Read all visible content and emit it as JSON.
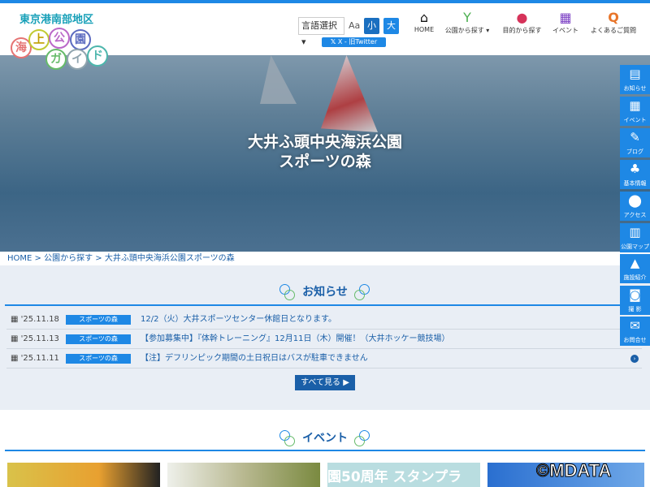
{
  "header": {
    "region": "東京港南部地区",
    "logo_text": [
      "海",
      "上",
      "公",
      "園",
      "ガ",
      "イ",
      "ド"
    ],
    "language_select": "言語選択",
    "font_size_label": "Aa",
    "font_small": "小",
    "font_large": "大",
    "twitter": "X - 旧Twitter",
    "nav": [
      {
        "label": "HOME",
        "icon": "home-icon"
      },
      {
        "label": "公園から探す ▾",
        "icon": "sprout-icon"
      },
      {
        "label": "目的から探す",
        "icon": "ball-icon"
      },
      {
        "label": "イベント",
        "icon": "calendar-icon"
      },
      {
        "label": "よくあるご質問",
        "icon": "q-icon"
      }
    ]
  },
  "hero": {
    "title_line1": "大井ふ頭中央海浜公園",
    "title_line2": "スポーツの森"
  },
  "breadcrumb": [
    "HOME",
    ">",
    "公園から探す",
    ">",
    "大井ふ頭中央海浜公園スポーツの森"
  ],
  "notices": {
    "title": "お知らせ",
    "items": [
      {
        "date": "'25.11.18",
        "tag": "スポーツの森",
        "text": "12/2（火）大井スポーツセンター休館日となります。"
      },
      {
        "date": "'25.11.13",
        "tag": "スポーツの森",
        "text": "【参加募集中】『体幹トレーニング』12月11日（木）開催！（大井ホッケー競技場）"
      },
      {
        "date": "'25.11.11",
        "tag": "スポーツの森",
        "text": "【注】デフリンピック期間の土日祝日はバスが駐車できません"
      }
    ],
    "more": "すべて見る ▶"
  },
  "events": {
    "title": "イベント",
    "card3_text": "園50周年 スタンプラ"
  },
  "sidebar": [
    {
      "label": "お知らせ",
      "icon": "newspaper-icon"
    },
    {
      "label": "イベント",
      "icon": "calendar-icon"
    },
    {
      "label": "ブログ",
      "icon": "edit-icon"
    },
    {
      "label": "基本情報",
      "icon": "tree-icon"
    },
    {
      "label": "アクセス",
      "icon": "map-pin-icon"
    },
    {
      "label": "公園マップ",
      "icon": "map-icon"
    },
    {
      "label": "施設紹介",
      "icon": "facility-icon"
    },
    {
      "label": "撮 影",
      "icon": "camera-icon"
    },
    {
      "label": "お問合せ",
      "icon": "mail-icon"
    }
  ],
  "watermark": "©MDATA"
}
